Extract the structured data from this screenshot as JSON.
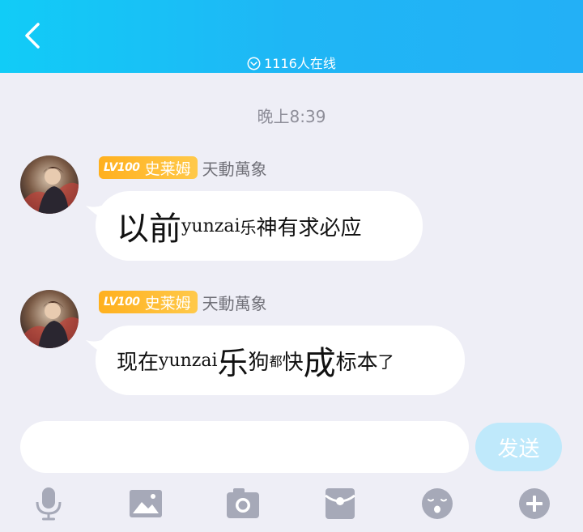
{
  "header": {
    "online_text": "1116人在线"
  },
  "time_label": "晚上8:39",
  "messages": [
    {
      "badge_level": "LV100",
      "badge_title": "史莱姆",
      "nickname": "天動萬象",
      "segments": [
        {
          "text": "以前",
          "size": 40
        },
        {
          "text": "yunzai",
          "size": 22
        },
        {
          "text": "乐",
          "size": 20
        },
        {
          "text": "神有求必应",
          "size": 26
        }
      ]
    },
    {
      "badge_level": "LV100",
      "badge_title": "史莱姆",
      "nickname": "天動萬象",
      "segments": [
        {
          "text": "现在",
          "size": 26
        },
        {
          "text": "yunzai",
          "size": 22
        },
        {
          "text": "乐",
          "size": 38
        },
        {
          "text": "狗",
          "size": 26
        },
        {
          "text": "都",
          "size": 16
        },
        {
          "text": "快",
          "size": 26
        },
        {
          "text": "成",
          "size": 40
        },
        {
          "text": "标本",
          "size": 26
        },
        {
          "text": "了",
          "size": 20
        }
      ]
    }
  ],
  "input": {
    "placeholder": "",
    "send_label": "发送"
  },
  "toolbar": [
    "mic-icon",
    "image-icon",
    "camera-icon",
    "red-packet-icon",
    "emoji-icon",
    "plus-icon"
  ],
  "colors": {
    "header_start": "#11ccf7",
    "header_end": "#23b0f6",
    "badge": "#ffb01e",
    "send_disabled": "#bfe9fb",
    "icon_gray": "#a6a9b8"
  }
}
